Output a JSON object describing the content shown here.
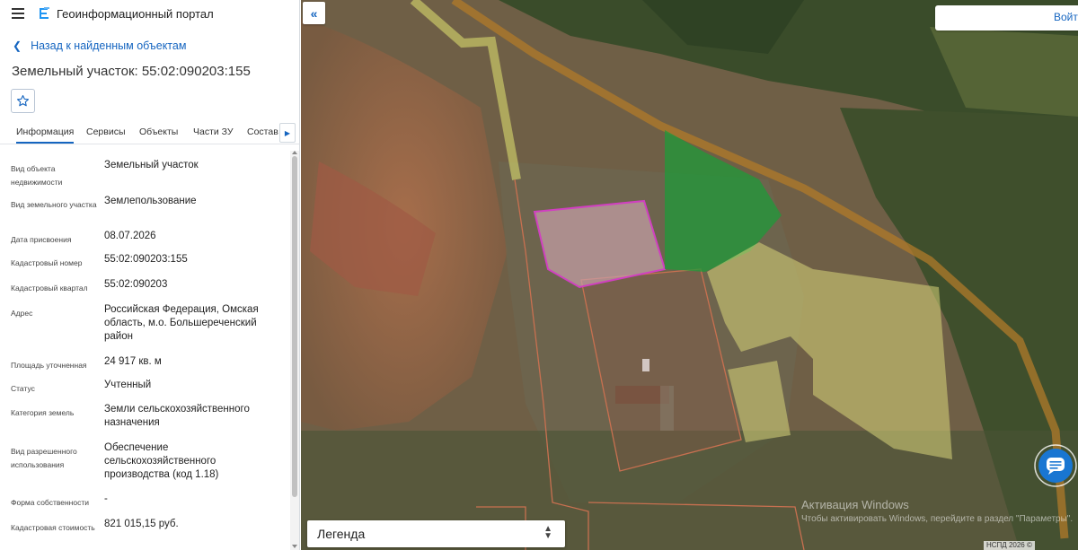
{
  "header": {
    "app_title": "Геоинформационный портал",
    "menu_icon": "hamburger-icon",
    "logo_icon": "portal-logo-icon"
  },
  "back_link": "Назад к найденным объектам",
  "object_title": "Земельный участок: 55:02:090203:155",
  "favorite_icon": "star-outline-icon",
  "tabs": [
    "Информация",
    "Сервисы",
    "Объекты",
    "Части ЗУ",
    "Состав"
  ],
  "active_tab": "Информация",
  "info_rows": [
    {
      "label": "Вид объекта недвижимости",
      "value": "Земельный участок"
    },
    {
      "label": "Вид земельного участка",
      "value": "Землепользование"
    },
    {
      "label": "Дата присвоения",
      "value": "08.07.2026"
    },
    {
      "label": "Кадастровый номер",
      "value": "55:02:090203:155"
    },
    {
      "label": "Кадастровый квартал",
      "value": "55:02:090203"
    },
    {
      "label": "Адрес",
      "value": "Российская Федерация, Омская область, м.о. Большереченский район"
    },
    {
      "label": "Площадь уточненная",
      "value": "24 917 кв. м"
    },
    {
      "label": "Статус",
      "value": "Учтенный"
    },
    {
      "label": "Категория земель",
      "value": "Земли сельскохозяйственного назначения"
    },
    {
      "label": "Вид разрешенного использования",
      "value": "Обеспечение сельскохозяйственного производства (код 1.18)"
    },
    {
      "label": "Форма собственности",
      "value": "-"
    },
    {
      "label": "Кадастровая стоимость",
      "value": "821 015,15 руб."
    }
  ],
  "map": {
    "login_label": "Войти",
    "legend_label": "Легенда",
    "windows_activation_title": "Активация Windows",
    "windows_activation_hint": "Чтобы активировать Windows, перейдите в раздел \"Параметры\".",
    "attribution": "НСПД 2026 ©",
    "colors": {
      "selected_parcel_fill": "#c8a0a8",
      "selected_parcel_border": "#d040c0",
      "parcel_border": "#c87050",
      "green_zone": "#1f9a3a",
      "yellow_zone": "#d9d57a",
      "road": "#b07a2a"
    }
  }
}
